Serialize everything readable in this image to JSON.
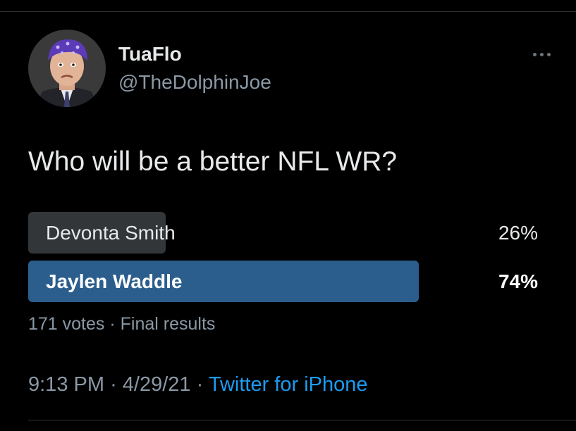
{
  "author": {
    "display_name": "TuaFlo",
    "handle": "@TheDolphinJoe",
    "avatar_icon": "user-avatar-bandana"
  },
  "tweet": {
    "text": "Who will be a better NFL WR?"
  },
  "poll": {
    "options": [
      {
        "label": "Devonta Smith",
        "percent_label": "26%",
        "percent": 26,
        "winner": false
      },
      {
        "label": "Jaylen Waddle",
        "percent_label": "74%",
        "percent": 74,
        "winner": true
      }
    ],
    "votes": "171 votes",
    "separator": "·",
    "status": "Final results"
  },
  "meta": {
    "time": "9:13 PM",
    "separator": "·",
    "date": "4/29/21",
    "source": "Twitter for iPhone"
  },
  "colors": {
    "background": "#000000",
    "winner_bar": "#2b5e8c",
    "loser_bar": "#333639",
    "link": "#1d9bf0",
    "secondary_text": "#8b98a5"
  },
  "icons": {
    "more": "more-horizontal-icon"
  }
}
